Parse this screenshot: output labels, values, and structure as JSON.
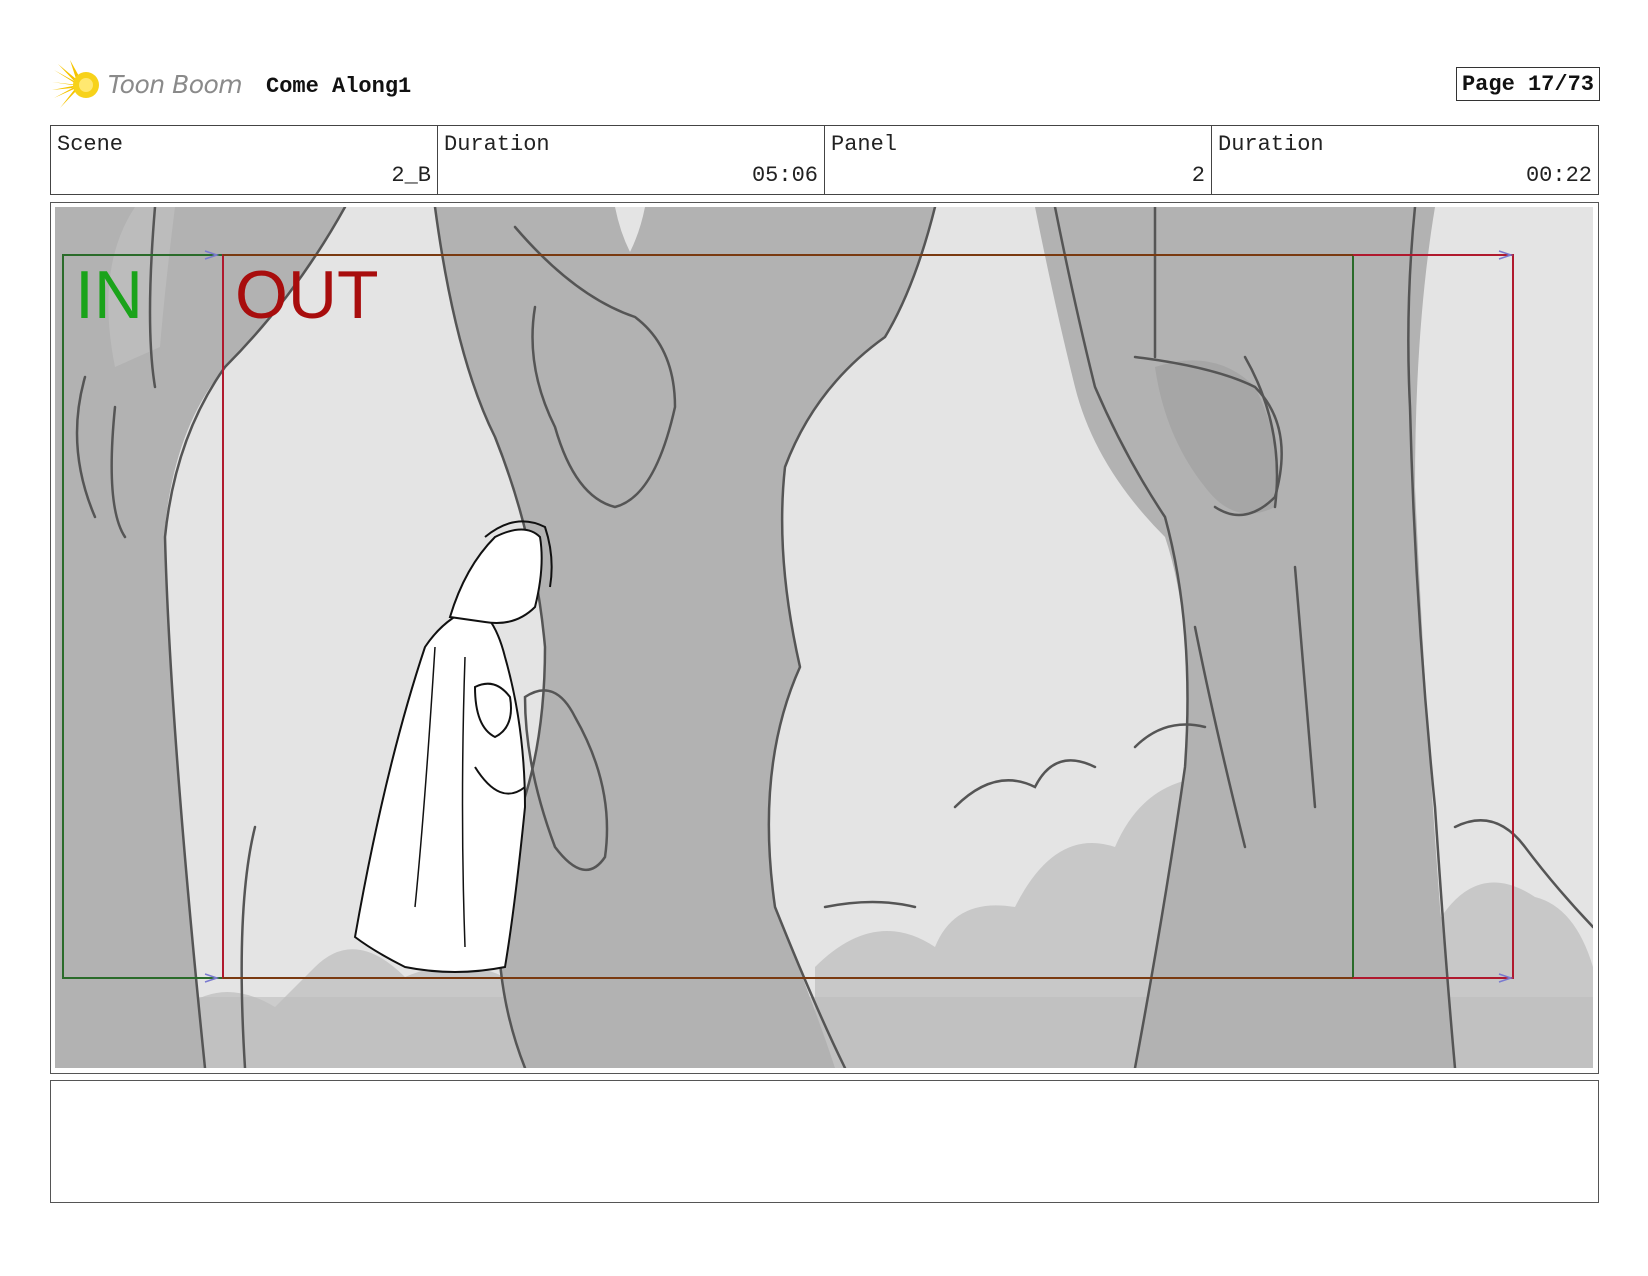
{
  "header": {
    "brand": "Toon Boom",
    "project_title": "Come Along1",
    "page_label": "Page 17/73"
  },
  "info": [
    {
      "label": "Scene",
      "value": "2_B"
    },
    {
      "label": "Duration",
      "value": "05:06"
    },
    {
      "label": "Panel",
      "value": "2"
    },
    {
      "label": "Duration",
      "value": "00:22"
    }
  ],
  "panel": {
    "in_label": "IN",
    "out_label": "OUT",
    "colors": {
      "in": "#1aa31a",
      "out": "#a80d0d",
      "in_frame": "#2a6b2a",
      "out_frame": "#b0192e",
      "sky": "#e4e4e4",
      "tree": "#b2b2b2",
      "bush": "#c8c8c8",
      "line": "#555555"
    }
  },
  "caption": {
    "text": ""
  }
}
